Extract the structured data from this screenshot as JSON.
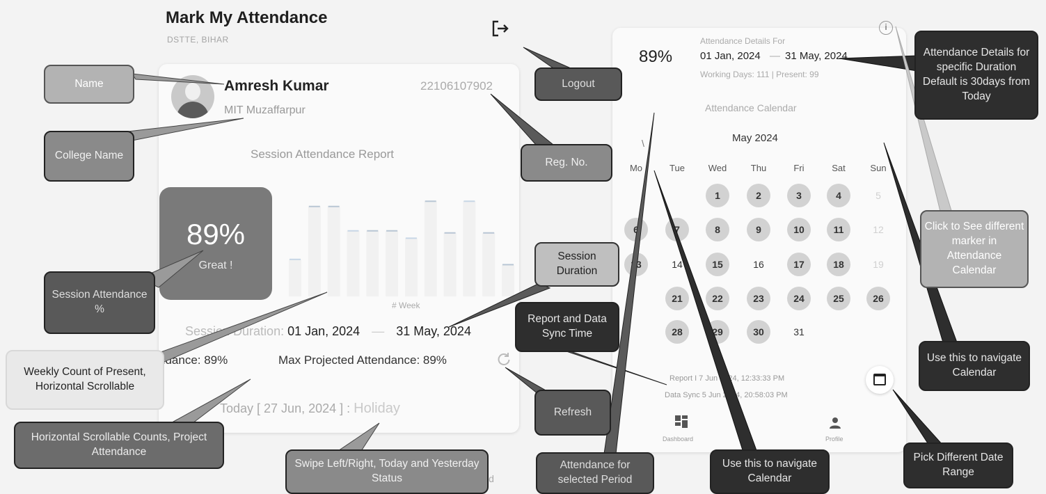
{
  "app": {
    "title": "Mark My Attendance",
    "subtitle": "DSTTE, BIHAR"
  },
  "user": {
    "name": "Amresh Kumar",
    "college": "MIT Muzaffarpur",
    "reg_no": "22106107902"
  },
  "session": {
    "report_title": "Session Attendance Report",
    "percent": "89%",
    "remark": "Great !",
    "week_axis_label": "# Week",
    "duration_label": "Session Duration:",
    "duration_from": "01 Jan, 2024",
    "duration_separator": "—",
    "duration_to": "31 May, 2024",
    "projected_attendance_partial": "ndance: 89%",
    "max_projected_attendance": "Max Projected Attendance: 89%",
    "today_label": "Today [ 27 Jun, 2024 ] :",
    "today_status": "Holiday",
    "footer_text": "yattend"
  },
  "details": {
    "percent": "89%",
    "for_label": "Attendance Details For",
    "from": "01 Jan, 2024",
    "separator": "—",
    "to": "31 May, 2024",
    "working_days": "Working Days: 111 | Present: 99"
  },
  "calendar": {
    "title": "Attendance Calendar",
    "month": "May 2024",
    "nav_marker": "\\",
    "weekdays": [
      "Mo",
      "Tue",
      "Wed",
      "Thu",
      "Fri",
      "Sat",
      "Sun"
    ],
    "weeks": [
      [
        {
          "d": ""
        },
        {
          "d": ""
        },
        {
          "d": "1",
          "s": "on"
        },
        {
          "d": "2",
          "s": "on"
        },
        {
          "d": "3",
          "s": "on"
        },
        {
          "d": "4",
          "s": "on"
        },
        {
          "d": "5",
          "s": "off"
        }
      ],
      [
        {
          "d": "6",
          "s": "on"
        },
        {
          "d": "7",
          "s": "on"
        },
        {
          "d": "8",
          "s": "on"
        },
        {
          "d": "9",
          "s": "on"
        },
        {
          "d": "10",
          "s": "on"
        },
        {
          "d": "11",
          "s": "on"
        },
        {
          "d": "12",
          "s": "off"
        }
      ],
      [
        {
          "d": "13",
          "s": "on"
        },
        {
          "d": "14",
          "s": "plain"
        },
        {
          "d": "15",
          "s": "on"
        },
        {
          "d": "16",
          "s": "plain"
        },
        {
          "d": "17",
          "s": "on"
        },
        {
          "d": "18",
          "s": "on"
        },
        {
          "d": "19",
          "s": "off"
        }
      ],
      [
        {
          "d": ""
        },
        {
          "d": "21",
          "s": "on"
        },
        {
          "d": "22",
          "s": "on"
        },
        {
          "d": "23",
          "s": "on"
        },
        {
          "d": "24",
          "s": "on"
        },
        {
          "d": "25",
          "s": "on"
        },
        {
          "d": "26",
          "s": "on"
        }
      ],
      [
        {
          "d": ""
        },
        {
          "d": "28",
          "s": "on"
        },
        {
          "d": "29",
          "s": "on"
        },
        {
          "d": "30",
          "s": "on"
        },
        {
          "d": "31",
          "s": "plain"
        },
        {
          "d": ""
        },
        {
          "d": ""
        }
      ]
    ]
  },
  "sync": {
    "report_line": "Report I       7 Jun 2024, 12:33:33 PM",
    "data_sync_line": "Data Sync       5 Jun 2024, 20:58:03 PM"
  },
  "bottom_nav": {
    "dashboard": "Dashboard",
    "profile": "Profile"
  },
  "weekly_chart": {
    "description_values": [
      0.35,
      0.85,
      0.85,
      0.62,
      0.62,
      0.62,
      0.55,
      0.9,
      0.6,
      0.9,
      0.6,
      0.3
    ],
    "accent": "#c7d6e6"
  },
  "callouts": {
    "name": "Name",
    "logout": "Logout",
    "attendance_details": "Attendance Details for specific Duration Default is 30days from Today",
    "college_name": "College Name",
    "reg_no": "Reg. No.",
    "click_markers": "Click to See different marker in Attendance Calendar",
    "session_attendance": "Session Attendance %",
    "session_duration": "Session Duration",
    "report_sync": "Report and Data Sync Time",
    "weekly_count": "Weekly Count of Present, Horizontal Scrollable",
    "navigate_calendar_right": "Use this to navigate Calendar",
    "horizontal_counts": "Horizontal Scrollable Counts, Project Attendance",
    "refresh": "Refresh",
    "swipe": "Swipe Left/Right, Today and Yesterday Status",
    "attendance_period": "Attendance for selected Period",
    "navigate_calendar_bottom": "Use this to navigate Calendar",
    "pick_range": "Pick Different Date Range"
  },
  "colors": {
    "callout_dark": "#595959",
    "callout_mid": "#8a8a8a",
    "callout_black": "#2e2e2e",
    "present_day": "#d2d2d2"
  }
}
